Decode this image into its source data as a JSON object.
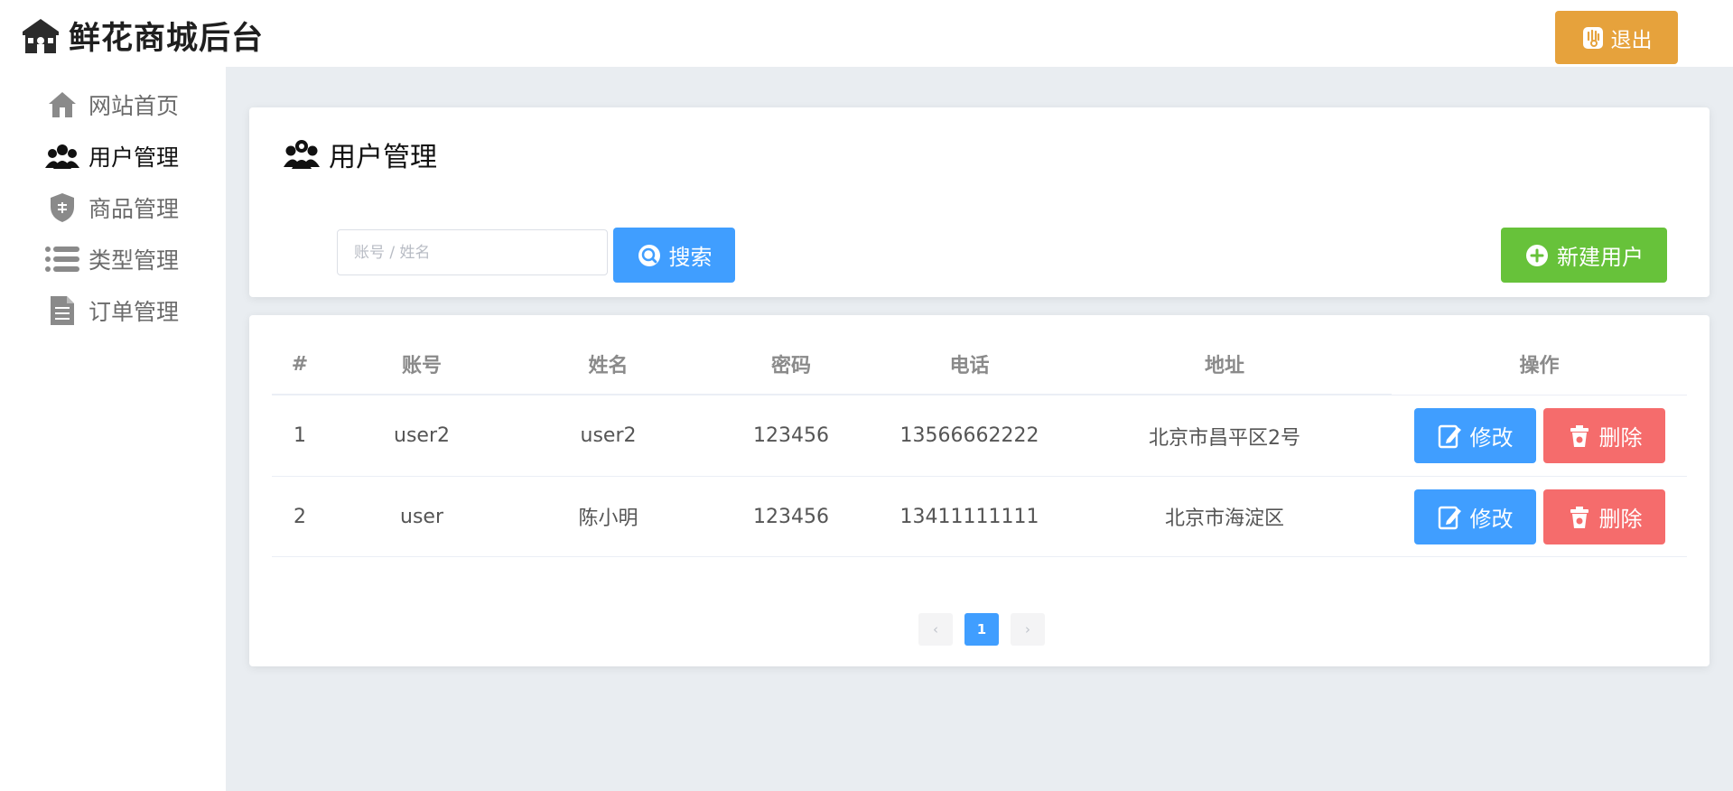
{
  "header": {
    "title": "鲜花商城后台",
    "logout_label": "退出"
  },
  "sidebar": {
    "items": [
      {
        "label": "网站首页",
        "icon": "home-icon",
        "active": false
      },
      {
        "label": "用户管理",
        "icon": "users-icon",
        "active": true
      },
      {
        "label": "商品管理",
        "icon": "shield-icon",
        "active": false
      },
      {
        "label": "类型管理",
        "icon": "list-icon",
        "active": false
      },
      {
        "label": "订单管理",
        "icon": "document-icon",
        "active": false
      }
    ]
  },
  "page": {
    "title": "用户管理",
    "search_placeholder": "账号 / 姓名",
    "search_value": "",
    "search_label": "搜索",
    "new_label": "新建用户"
  },
  "table": {
    "columns": [
      "#",
      "账号",
      "姓名",
      "密码",
      "电话",
      "地址",
      "操作"
    ],
    "rows": [
      {
        "index": "1",
        "account": "user2",
        "name": "user2",
        "password": "123456",
        "phone": "13566662222",
        "address": "北京市昌平区2号"
      },
      {
        "index": "2",
        "account": "user",
        "name": "陈小明",
        "password": "123456",
        "phone": "13411111111",
        "address": "北京市海淀区"
      }
    ],
    "edit_label": "修改",
    "delete_label": "删除"
  },
  "pagination": {
    "prev": "‹",
    "current": "1",
    "next": "›"
  },
  "colors": {
    "primary": "#409eff",
    "success": "#67c23a",
    "warning": "#e6a23c",
    "danger": "#f56c6c",
    "background": "#e9edf1"
  }
}
